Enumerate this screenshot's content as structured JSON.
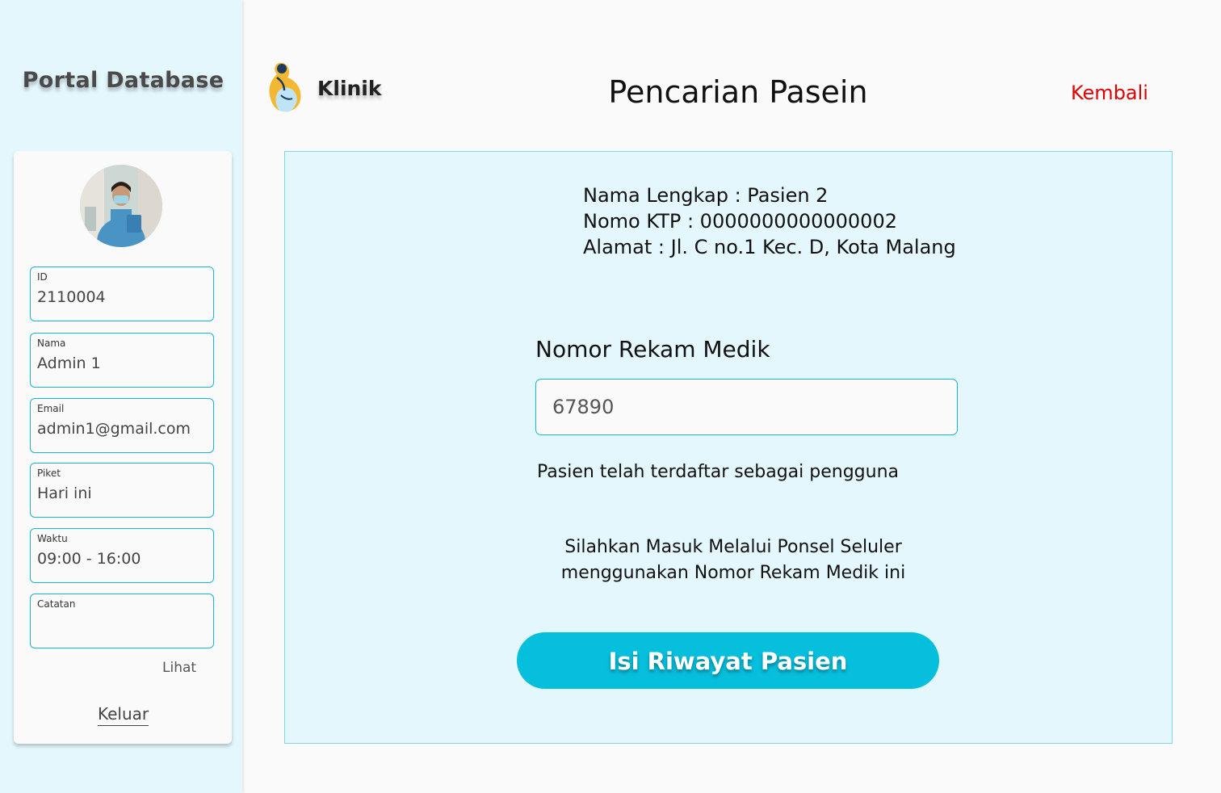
{
  "sidebar": {
    "title": "Portal Database",
    "profile": {
      "fields": [
        {
          "label": "ID",
          "value": "2110004"
        },
        {
          "label": "Nama",
          "value": "Admin 1"
        },
        {
          "label": "Email",
          "value": "admin1@gmail.com"
        },
        {
          "label": "Piket",
          "value": "Hari ini"
        },
        {
          "label": "Waktu",
          "value": "09:00 - 16:00"
        },
        {
          "label": "Catatan",
          "value": ""
        }
      ],
      "lihat_label": "Lihat",
      "logout_label": "Keluar"
    }
  },
  "header": {
    "brand": "Klinik",
    "title": "Pencarian Pasein",
    "back_label": "Kembali"
  },
  "patient": {
    "name_line": "Nama Lengkap : Pasien 2",
    "ktp_line": "Nomo KTP : 0000000000000002",
    "address_line": "Alamat : Jl. C no.1 Kec. D, Kota Malang"
  },
  "medical_record": {
    "label": "Nomor Rekam Medik",
    "value": "67890"
  },
  "status_message": "Pasien telah terdaftar sebagai pengguna",
  "instruction": {
    "line1": "Silahkan Masuk Melalui Ponsel Seluler",
    "line2": "menggunakan Nomor Rekam Medik ini"
  },
  "cta_label": "Isi Riwayat Pasien",
  "colors": {
    "accent": "#06bfdd",
    "border": "#15b8d4",
    "sidebar_bg": "#e3f7fd",
    "back_link": "#e00000"
  }
}
